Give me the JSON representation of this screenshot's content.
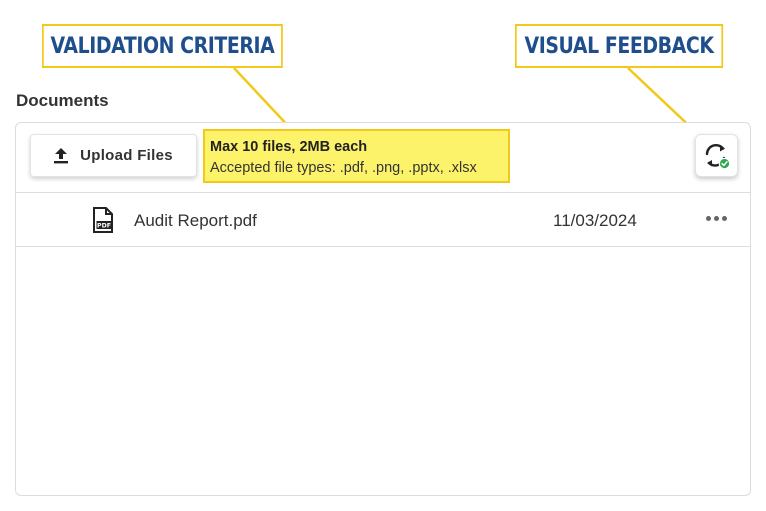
{
  "callouts": {
    "validation": "VALIDATION CRITERIA",
    "visual": "VISUAL FEEDBACK"
  },
  "section": {
    "title": "Documents"
  },
  "toolbar": {
    "upload_label": "Upload Files",
    "upload_icon": "upload-icon",
    "refresh_icon": "refresh-success-icon"
  },
  "criteria": {
    "line1": "Max 10 files, 2MB each",
    "line2": "Accepted file types: .pdf, .png, .pptx, .xlsx"
  },
  "files": [
    {
      "icon": "pdf-file-icon",
      "icon_label": "PDF",
      "name": "Audit Report.pdf",
      "date": "11/03/2024",
      "menu_icon": "more-horizontal-icon"
    }
  ],
  "colors": {
    "callout_border": "#f2c81a",
    "callout_text": "#1f4e8c",
    "highlight_fill": "#fdf36b",
    "success_green": "#2fa84f"
  }
}
